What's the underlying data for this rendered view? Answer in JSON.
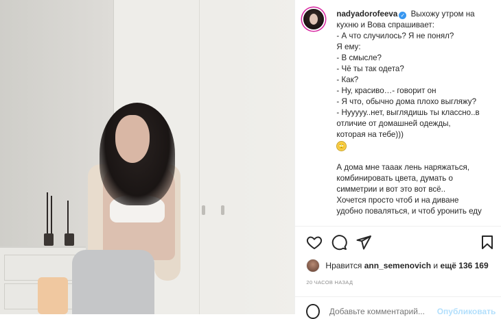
{
  "post": {
    "username": "nadyadorofeeva",
    "caption_lines": [
      "Выхожу утром на",
      "кухню и Вова спрашивает:",
      "- А что случилось? Я не понял?",
      "Я ему:",
      "- В смысле?",
      "- Чё ты так одета?",
      "- Как?",
      "- Ну, красиво…- говорит он",
      "- Я что, обычно дома плохо выгляжу?",
      "- Нууууу..нет, выглядишь ты классно..в",
      "отличие от домашней одежды,",
      "которая на тебе)))",
      "",
      "А дома мне тааак лень наряжаться,",
      "комбинировать цвета, думать о",
      "симметрии и вот это вот всё..",
      "Хочется просто чтоб и на диване",
      "удобно поваляться, и чтоб уронить еду"
    ],
    "emoji_after": "🙄"
  },
  "actions": {
    "like_icon": "heart-icon",
    "comment_icon": "comment-icon",
    "share_icon": "share-icon",
    "save_icon": "bookmark-icon"
  },
  "likes": {
    "prefix": "Нравится",
    "user": "ann_semenovich",
    "middle": "и",
    "others": "ещё 136 169"
  },
  "timestamp": "20 ЧАСОВ НАЗАД",
  "comment": {
    "placeholder": "Добавьте комментарий...",
    "post_label": "Опубликовать"
  }
}
